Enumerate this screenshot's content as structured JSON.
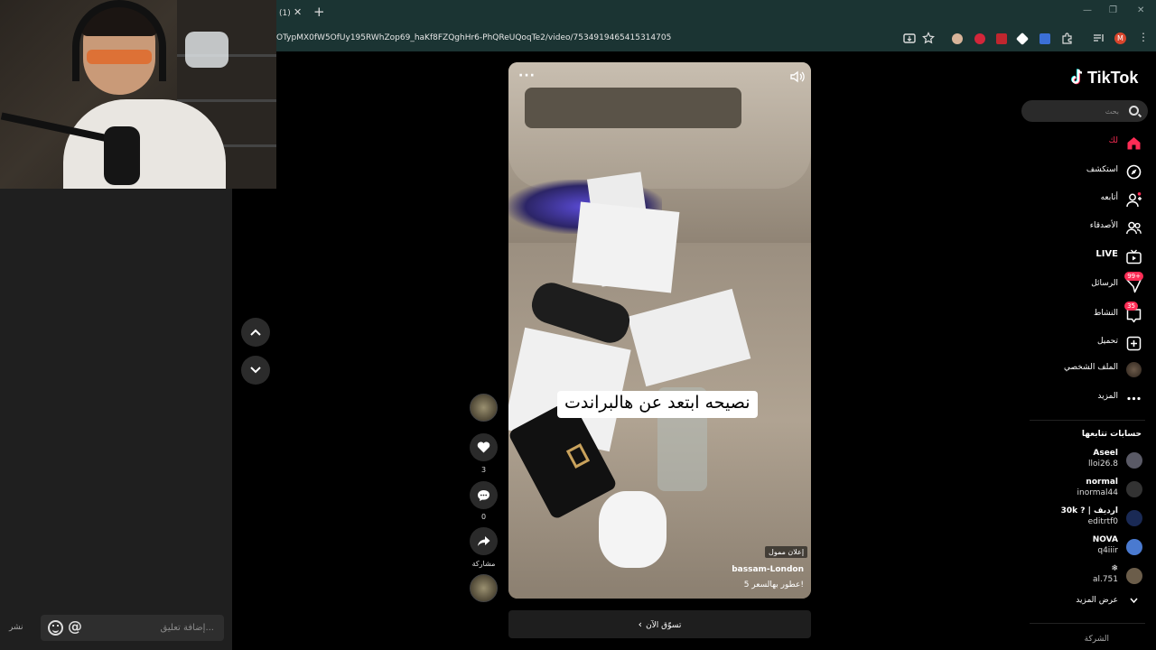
{
  "stream": {
    "chat_placeholder": "إضافة تعليق...",
    "chat_send": "نشر"
  },
  "browser": {
    "tab_title": "(1)",
    "url": "OTypMX0fW5OfUy195RWhZop69_haKf8FZQghHr6-PhQReUQoqTe2/video/7534919465415314705"
  },
  "video": {
    "caption_overlay": "نصيحه ابتعد عن هالبراندت",
    "sponsored": "إعلان ممول",
    "author": "bassam-London",
    "description": "5 عطور بهالسعر!",
    "likes": "3",
    "comments": "0",
    "share_label": "مشاركة",
    "shop_now": "تسوّق الآن"
  },
  "sidebar": {
    "logo": "TikTok",
    "search_placeholder": "بحث",
    "nav": [
      {
        "label": "لك",
        "icon": "home-icon",
        "active": true
      },
      {
        "label": "استكشف",
        "icon": "compass-icon"
      },
      {
        "label": "أتابعه",
        "icon": "following-icon"
      },
      {
        "label": "الأصدقاء",
        "icon": "friends-icon"
      },
      {
        "label": "LIVE",
        "icon": "live-icon"
      },
      {
        "label": "الرسائل",
        "icon": "messages-icon",
        "badge": "99+"
      },
      {
        "label": "النشاط",
        "icon": "activity-icon",
        "badge": "35"
      },
      {
        "label": "تحميل",
        "icon": "upload-icon"
      },
      {
        "label": "الملف الشخصي",
        "icon": "profile-avatar"
      },
      {
        "label": "المزيد",
        "icon": "more-icon"
      }
    ],
    "following_title": "حسابات تتابعها",
    "following": [
      {
        "name": "Aseel",
        "handle": "lloi26.8"
      },
      {
        "name": "normal",
        "handle": "inormal44"
      },
      {
        "name": "30k ? | ارديف",
        "handle": "editrtf0"
      },
      {
        "name": "NOVA",
        "handle": "q4iiir"
      },
      {
        "name": "❄",
        "handle": "al.751"
      }
    ],
    "see_more": "عرض المزيد",
    "company": "الشركة"
  },
  "colors": {
    "accent": "#fe2c55",
    "browser_bar": "#1b3433"
  }
}
